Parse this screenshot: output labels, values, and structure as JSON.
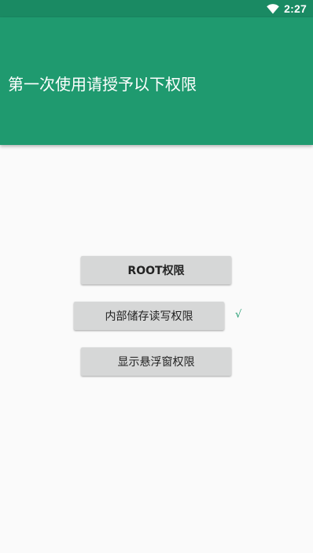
{
  "status_bar": {
    "time": "2:27",
    "icons": [
      "wifi-icon"
    ]
  },
  "header": {
    "title": "第一次使用请授予以下权限"
  },
  "buttons": {
    "root_label": "ROOT权限",
    "storage_label": "内部储存读写权限",
    "overlay_label": "显示悬浮窗权限"
  },
  "status": {
    "storage_granted_mark": "√"
  },
  "colors": {
    "accent": "#1f9a6f",
    "status_bar": "#1a8a63",
    "button_bg": "#d6d7d7",
    "background": "#fafafa"
  }
}
